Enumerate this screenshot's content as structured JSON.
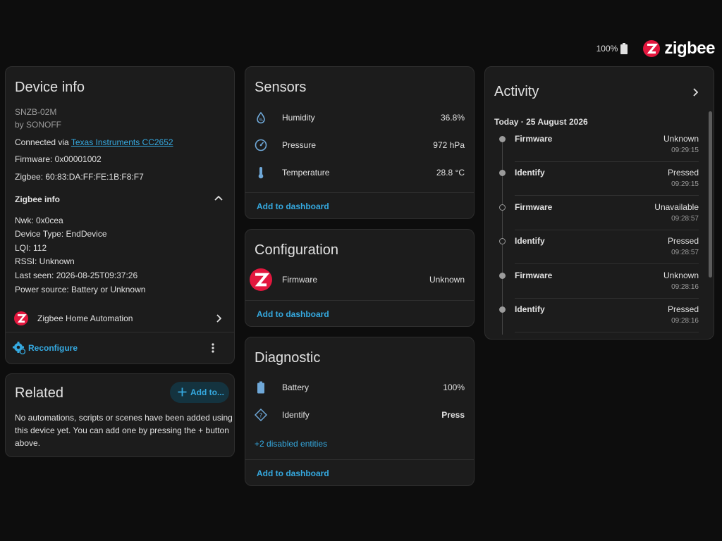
{
  "topbar": {
    "battery_text": "100%",
    "brand": "zigbee"
  },
  "device_info": {
    "title": "Device info",
    "model": "SNZB-02M",
    "manufacturer": "by SONOFF",
    "connected_prefix": "Connected via ",
    "connected_link": "Texas Instruments CC2652",
    "firmware": "Firmware: 0x00001002",
    "zigbee": "Zigbee: 60:83:DA:FF:FE:1B:F8:F7",
    "zigbee_info_label": "Zigbee info",
    "nwk": "Nwk: 0x0cea",
    "device_type": "Device Type: EndDevice",
    "lqi": "LQI: 112",
    "rssi": "RSSI: Unknown",
    "last_seen": "Last seen: 2026-08-25T09:37:26",
    "power_source": "Power source: Battery or Unknown",
    "integration": "Zigbee Home Automation",
    "reconfigure": "Reconfigure"
  },
  "related": {
    "title": "Related",
    "add_button": "Add to...",
    "message_l1": "No automations, scripts or scenes have been added using",
    "message_l2": "this device yet. You can add one by pressing the + button",
    "message_l3": "above."
  },
  "sensors": {
    "title": "Sensors",
    "rows": [
      {
        "label": "Humidity",
        "value": "36.8%",
        "icon": "water-drop-icon"
      },
      {
        "label": "Pressure",
        "value": "972 hPa",
        "icon": "gauge-icon"
      },
      {
        "label": "Temperature",
        "value": "28.8 °C",
        "icon": "thermometer-icon"
      }
    ],
    "action": "Add to dashboard"
  },
  "configuration": {
    "title": "Configuration",
    "label": "Firmware",
    "value": "Unknown",
    "action": "Add to dashboard"
  },
  "diagnostic": {
    "title": "Diagnostic",
    "battery_label": "Battery",
    "battery_value": "100%",
    "identify_label": "Identify",
    "identify_action": "Press",
    "disabled": "+2 disabled entities",
    "action": "Add to dashboard"
  },
  "activity": {
    "title": "Activity",
    "date": "Today · 25 August 2026",
    "items": [
      {
        "name": "Firmware",
        "state": "Unknown",
        "time": "09:29:15"
      },
      {
        "name": "Identify",
        "state": "Pressed",
        "time": "09:29:15"
      },
      {
        "name": "Firmware",
        "state": "Unavailable",
        "time": "09:28:57"
      },
      {
        "name": "Identify",
        "state": "Pressed",
        "time": "09:28:57"
      },
      {
        "name": "Firmware",
        "state": "Unknown",
        "time": "09:28:16"
      },
      {
        "name": "Identify",
        "state": "Pressed",
        "time": "09:28:16"
      }
    ]
  },
  "colors": {
    "accent": "#35a9e0",
    "brand_red": "#e3173e",
    "card_bg": "#1c1c1c",
    "page_bg": "#0d0d0d"
  }
}
